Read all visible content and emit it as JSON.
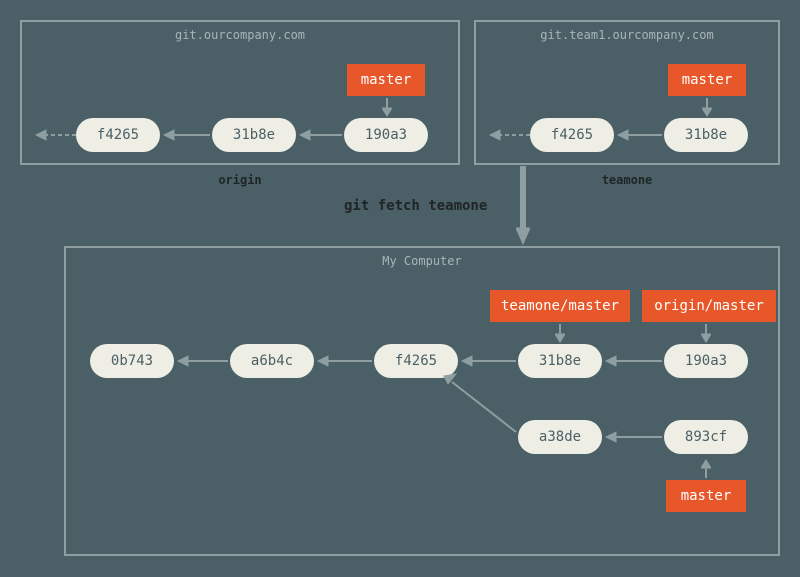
{
  "origin": {
    "title": "git.ourcompany.com",
    "caption": "origin",
    "ref": "master",
    "commits": [
      "f4265",
      "31b8e",
      "190a3"
    ]
  },
  "teamone": {
    "title": "git.team1.ourcompany.com",
    "caption": "teamone",
    "ref": "master",
    "commits": [
      "f4265",
      "31b8e"
    ]
  },
  "fetch_label": "git fetch teamone",
  "local": {
    "title": "My Computer",
    "refs": {
      "teamone": "teamone/master",
      "origin": "origin/master",
      "local": "master"
    },
    "commits_main": [
      "0b743",
      "a6b4c",
      "f4265",
      "31b8e",
      "190a3"
    ],
    "commits_alt": [
      "a38de",
      "893cf"
    ]
  },
  "colors": {
    "bg": "#4a6066",
    "border": "#8e9ea1",
    "commit": "#efeee4",
    "ref": "#e8572a"
  }
}
